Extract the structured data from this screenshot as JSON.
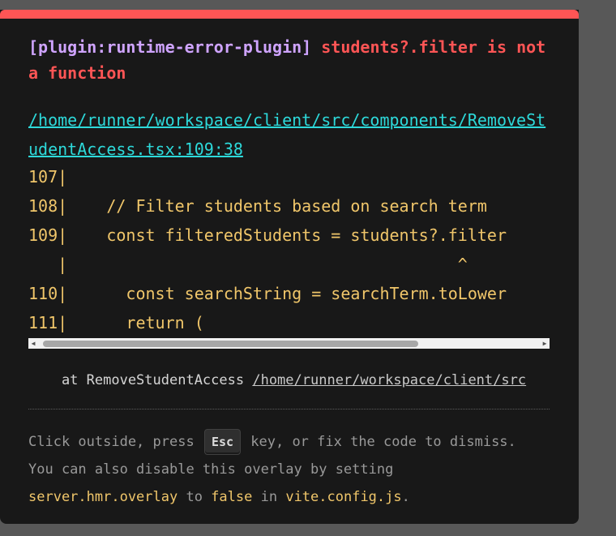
{
  "overlay": {
    "plugin_tag": "[plugin:runtime-error-plugin]",
    "message": "students?.filter is not a function",
    "file_path": "/home/runner/workspace/client/src/components/RemoveStudentAccess.tsx:109:38",
    "code_lines": [
      "107|",
      "108|    // Filter students based on search term",
      "109|    const filteredStudents = students?.filter",
      "   |                                        ^",
      "110|      const searchString = searchTerm.toLower",
      "111|      return ("
    ],
    "stack_prefix": "    at RemoveStudentAccess ",
    "stack_path": "/home/runner/workspace/client/src",
    "tip": {
      "part1": "Click outside, press ",
      "esc_key": "Esc",
      "part2": " key, or fix the code to dismiss.",
      "line2": "You can also disable this overlay by setting",
      "setting": "server.hmr.overlay",
      "to": " to ",
      "value": "false",
      "in": " in ",
      "config_file": "vite.config.js",
      "period": "."
    }
  },
  "colors": {
    "accent_bar": "#ff5555",
    "plugin": "#cfa4ff",
    "error": "#ff5555",
    "link": "#2dd9da",
    "code": "#f0c66a",
    "background": "#181818"
  }
}
